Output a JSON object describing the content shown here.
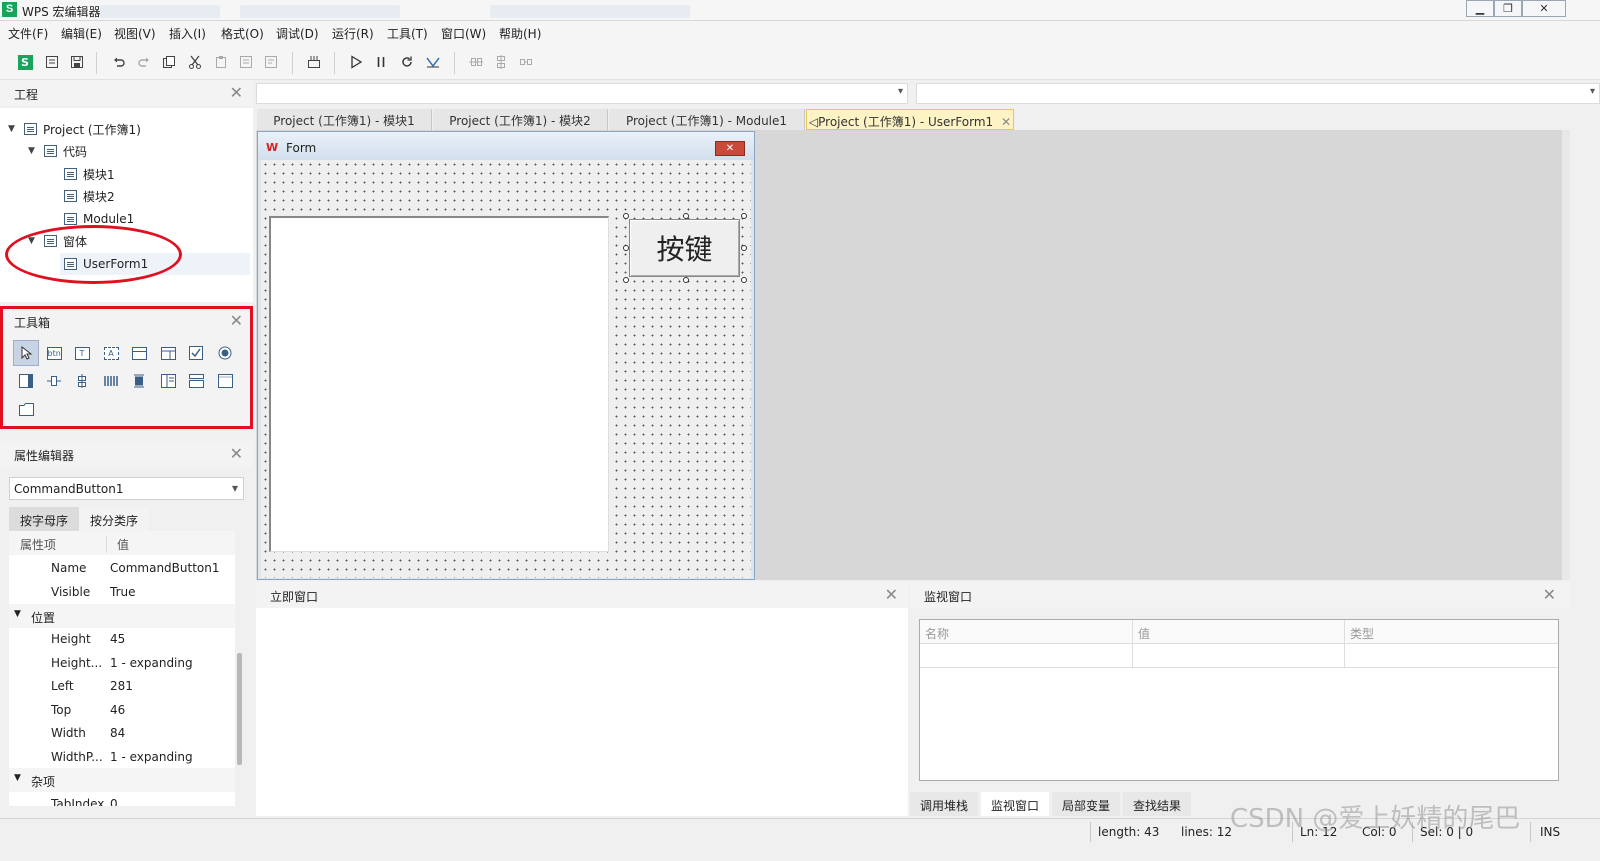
{
  "app": {
    "logo": "S",
    "title": "WPS 宏编辑器"
  },
  "window_buttons": {
    "minimize": "▁",
    "restore": "❐",
    "close": "✕"
  },
  "menu": [
    "文件(F)",
    "编辑(E)",
    "视图(V)",
    "插入(I)",
    "格式(O)",
    "调试(D)",
    "运行(R)",
    "工具(T)",
    "窗口(W)",
    "帮助(H)"
  ],
  "toolbar_icons": [
    "wps-logo-icon",
    "save-as-icon",
    "save-icon",
    "undo-icon",
    "redo-icon",
    "copy-icon",
    "cut-icon",
    "paste-icon",
    "comment-icon",
    "uncomment-icon",
    "object-browser-icon",
    "run-icon",
    "pause-icon",
    "reset-icon",
    "design-mode-icon",
    "align-left-icon",
    "align-center-icon",
    "align-right-icon"
  ],
  "project_pane": {
    "title": "工程",
    "close": "✕",
    "tree": [
      {
        "label": "Project (工作簿1)",
        "arrow": "▼",
        "level": 0
      },
      {
        "label": "代码",
        "arrow": "▼",
        "level": 1
      },
      {
        "label": "模块1",
        "arrow": "",
        "level": 2
      },
      {
        "label": "模块2",
        "arrow": "",
        "level": 2
      },
      {
        "label": "Module1",
        "arrow": "",
        "level": 2
      },
      {
        "label": "窗体",
        "arrow": "▼",
        "level": 1
      },
      {
        "label": "UserForm1",
        "arrow": "",
        "level": 2
      }
    ]
  },
  "toolbox_pane": {
    "title": "工具箱",
    "close": "✕",
    "tools": [
      "pointer-icon",
      "button-icon",
      "textbox-icon",
      "label-icon",
      "frame-icon",
      "combobox-icon",
      "checkbox-icon",
      "radio-icon",
      "listbox-icon",
      "spinbutton-icon",
      "scrollbar-icon",
      "tabstrip-icon",
      "multipage-icon",
      "togglebutton-icon",
      "image-icon",
      "refedit-icon",
      "folder-icon"
    ],
    "tool_glyphs": {
      "button-icon": "btn",
      "textbox-icon": "T",
      "label-icon": "A"
    }
  },
  "properties_pane": {
    "title": "属性编辑器",
    "close": "✕",
    "selected_object": "CommandButton1",
    "tabs": [
      "按字母序",
      "按分类序"
    ],
    "header": {
      "key": "属性项",
      "value": "值"
    },
    "rows": [
      {
        "type": "prop",
        "key": "Name",
        "value": "CommandButton1"
      },
      {
        "type": "prop",
        "key": "Visible",
        "value": "True"
      },
      {
        "type": "cat",
        "key": "位置",
        "value": ""
      },
      {
        "type": "prop",
        "key": "Height",
        "value": "45"
      },
      {
        "type": "prop",
        "key": "Height...",
        "value": "1 - expanding"
      },
      {
        "type": "prop",
        "key": "Left",
        "value": "281"
      },
      {
        "type": "prop",
        "key": "Top",
        "value": "46"
      },
      {
        "type": "prop",
        "key": "Width",
        "value": "84"
      },
      {
        "type": "prop",
        "key": "WidthP...",
        "value": "1 - expanding"
      },
      {
        "type": "cat",
        "key": "杂项",
        "value": ""
      },
      {
        "type": "prop",
        "key": "TabIndex",
        "value": "0"
      }
    ]
  },
  "editor": {
    "tabs": [
      {
        "label": "Project (工作簿1) - 模块1",
        "active": false
      },
      {
        "label": "Project (工作簿1) - 模块2",
        "active": false
      },
      {
        "label": "Project (工作簿1) - Module1",
        "active": false
      },
      {
        "label": "Project (工作簿1) - UserForm1",
        "active": true
      }
    ],
    "active_tab_close": "✕",
    "form": {
      "logo": "W",
      "title": "Form",
      "close": "✕",
      "button_label": "按键"
    }
  },
  "immediate_pane": {
    "title": "立即窗口",
    "close": "✕"
  },
  "watch_pane": {
    "title": "监视窗口",
    "close": "✕",
    "columns": [
      "名称",
      "值",
      "类型"
    ],
    "tabs": [
      "调用堆栈",
      "监视窗口",
      "局部变量",
      "查找结果"
    ],
    "active_tab": 1
  },
  "status": {
    "length": "length: 43",
    "lines": "lines: 12",
    "ln": "Ln: 12",
    "col": "Col: 0",
    "sel": "Sel: 0 | 0",
    "mode": "INS"
  },
  "watermark": "CSDN @爱上妖精的尾巴"
}
